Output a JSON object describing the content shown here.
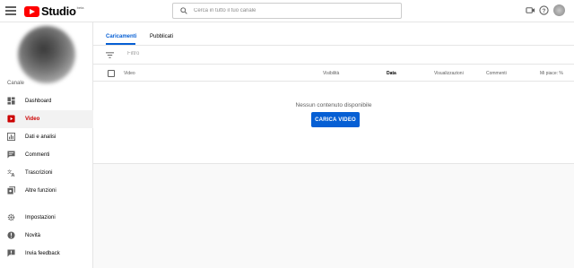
{
  "header": {
    "app_name": "Studio",
    "beta_label": "beta",
    "search_placeholder": "Cerca in tutto il tuo canale"
  },
  "sidebar": {
    "section_label": "Canale",
    "items": [
      {
        "label": "Dashboard",
        "icon": "dashboard-icon"
      },
      {
        "label": "Video",
        "icon": "video-icon",
        "active": true
      },
      {
        "label": "Dati e analisi",
        "icon": "analytics-icon"
      },
      {
        "label": "Commenti",
        "icon": "comments-icon"
      },
      {
        "label": "Trascrizioni",
        "icon": "translate-icon"
      },
      {
        "label": "Altre funzioni",
        "icon": "more-functions-icon"
      },
      {
        "label": "Impostazioni",
        "icon": "gear-icon"
      },
      {
        "label": "Novità",
        "icon": "news-icon"
      },
      {
        "label": "Invia feedback",
        "icon": "feedback-icon"
      }
    ]
  },
  "main": {
    "tabs": [
      {
        "label": "Caricamenti",
        "active": true
      },
      {
        "label": "Pubblicati"
      }
    ],
    "filter_placeholder": "Filtro",
    "columns": [
      "Video",
      "Visibilità",
      "Data",
      "Visualizzazioni",
      "Commenti",
      "Mi piace: %"
    ],
    "empty_message": "Nessun contenuto disponibile",
    "upload_button": "CARICA VIDEO"
  },
  "colors": {
    "brand_red": "#ff0000",
    "accent_blue": "#065fd4",
    "active_nav_red": "#cc0000"
  }
}
